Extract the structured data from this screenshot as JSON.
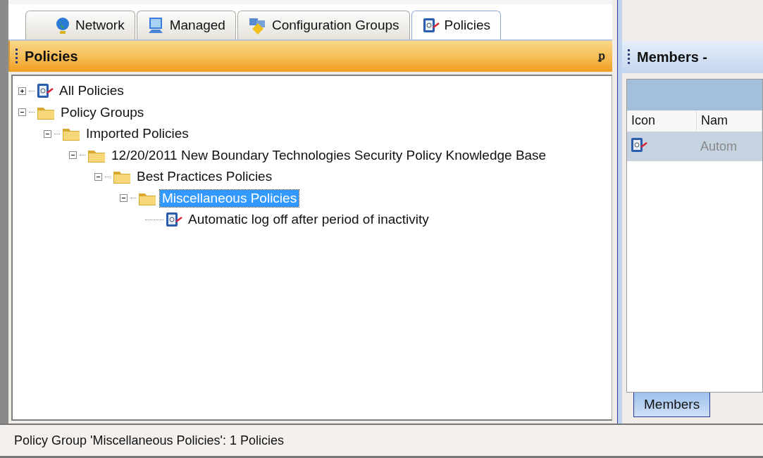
{
  "tabs": [
    {
      "label": "Network",
      "selected": false
    },
    {
      "label": "Managed",
      "selected": false
    },
    {
      "label": "Configuration Groups",
      "selected": false
    },
    {
      "label": "Policies",
      "selected": true
    }
  ],
  "left_panel": {
    "title": "Policies",
    "pin": "ᵱ",
    "tree": [
      {
        "label": "All Policies",
        "kind": "policy",
        "expanded": false,
        "selected": false
      },
      {
        "label": "Policy Groups",
        "kind": "folder",
        "expanded": true,
        "selected": false,
        "children": [
          {
            "label": "Imported Policies",
            "kind": "folder",
            "expanded": true,
            "selected": false,
            "children": [
              {
                "label": "12/20/2011 New Boundary Technologies Security Policy Knowledge Base",
                "kind": "folder",
                "expanded": true,
                "selected": false,
                "children": [
                  {
                    "label": "Best Practices Policies",
                    "kind": "folder",
                    "expanded": true,
                    "selected": false,
                    "children": [
                      {
                        "label": "Miscellaneous Policies",
                        "kind": "folder",
                        "expanded": true,
                        "selected": true,
                        "children": [
                          {
                            "label": "Automatic log off after period of inactivity",
                            "kind": "policy",
                            "selected": false
                          }
                        ]
                      }
                    ]
                  }
                ]
              }
            ]
          }
        ]
      }
    ]
  },
  "right_panel": {
    "title": "Members -",
    "columns": [
      "Icon",
      "Nam"
    ],
    "rows": [
      {
        "name": "Autom",
        "selected": true
      }
    ],
    "bottom_tabs": [
      {
        "label": "Members",
        "selected": true
      }
    ]
  },
  "status_bar": "Policy Group 'Miscellaneous Policies': 1 Policies"
}
